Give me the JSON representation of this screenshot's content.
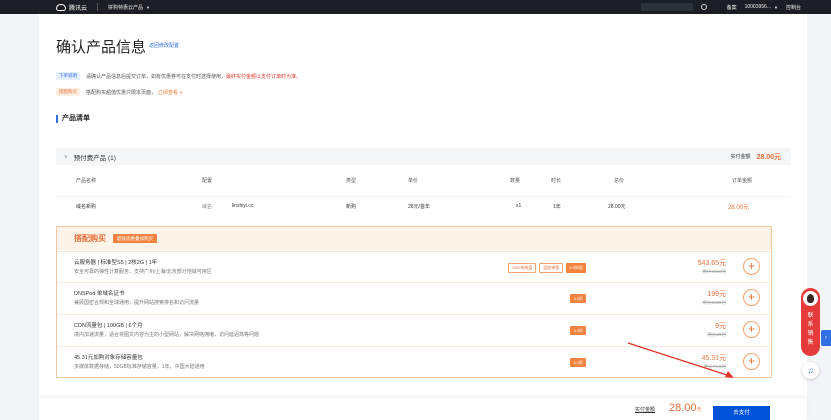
{
  "topbar": {
    "logo_text": "腾讯云",
    "nav_label": "拼购特惠云产品",
    "account": "备案",
    "account_id": "10003956...",
    "console": "控制台"
  },
  "page": {
    "title": "确认产品信息",
    "back_link": "返回修改配置"
  },
  "notices": [
    {
      "tag": "下单说明",
      "text": "请确认产品信息后提交订单，如有优惠券可在支付时选择使用，",
      "highlight": "最终实付金额以支付订单时为准。"
    },
    {
      "tag": "搭配购买",
      "text": "搭配购买超值优惠只限本页面，",
      "link": "立即查看 ∨"
    }
  ],
  "section_title": "产品清单",
  "group": {
    "title": "预付费产品 (1)",
    "paid_label": "实付金额",
    "paid_amount": "28.00元"
  },
  "table": {
    "headers": [
      "产品名称",
      "配置",
      "类型",
      "单价",
      "数量",
      "时长",
      "总价",
      "订单金额"
    ],
    "row": {
      "name": "域名新购",
      "config_label": "域名",
      "config_value": "linzhiyi.cc",
      "type": "新购",
      "unit_price": "28元/首年",
      "qty": "x1",
      "duration": "1年",
      "total": "28.00元",
      "order_amount": "28.00元"
    }
  },
  "addon": {
    "title": "搭配购买",
    "badge": "超低优惠叠加购买",
    "items": [
      {
        "name": "云服务器 | 标准型S5 | 2核2G | 1年",
        "desc": "安全可靠的弹性计算服务，支持广州/上海/北京部分地域可用区",
        "tags": [
          "SSD系统盘",
          "固定带宽"
        ],
        "discount": "5.9折起",
        "price": "543.65元",
        "orig": "原价9999元"
      },
      {
        "name": "DNSPod 单域名证书",
        "desc": "兼顾国密合规和全球通用，提升网站搜索排名和访问流量",
        "tags": [],
        "discount": "3.6折",
        "price": "199元",
        "orig": "原价5555元"
      },
      {
        "name": "CDN流量包 | 100GB | 6个月",
        "desc": "境内加速流量，适合将图文内容为主的小型网站，解决网络拥堵，访问延迟高等问题",
        "tags": [],
        "discount": "4.5折",
        "price": "9元",
        "orig": "原价20元"
      },
      {
        "name": "45.31元加购对象存储容量包",
        "desc": "多媒体数据存储，50GB标准存储容量，1年，中国大陆通用",
        "tags": [],
        "discount": "6.4折",
        "price": "45.31元",
        "orig": "原价70.8元"
      }
    ]
  },
  "bottom": {
    "label": "实付金额",
    "amount": "28.00",
    "unit": "元",
    "pay_button": "去支付"
  },
  "float": {
    "contact_text": "联系销售"
  },
  "colors": {
    "accent": "#e8703a",
    "primary": "#0052d9",
    "topbar": "#1b1e24",
    "contact": "#e63b3b"
  }
}
